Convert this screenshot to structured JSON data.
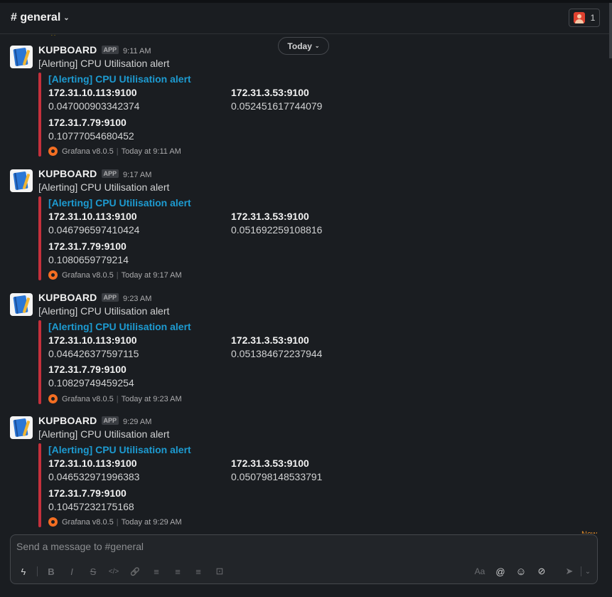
{
  "channel": {
    "title": "# general",
    "member_count": "1"
  },
  "date_divider": "Today",
  "messages": [
    {
      "sender": "KUPBOARD",
      "badge": "APP",
      "time": "9:11 AM",
      "text": "[Alerting] CPU Utilisation alert",
      "attachment": {
        "title": "[Alerting] CPU Utilisation alert",
        "fields": [
          {
            "name": "172.31.10.113:9100",
            "value": "0.047000903342374"
          },
          {
            "name": "172.31.3.53:9100",
            "value": "0.052451617744079"
          },
          {
            "name": "172.31.7.79:9100",
            "value": "0.10777054680452"
          }
        ],
        "footer": "Grafana v8.0.5",
        "footer_time": "Today at 9:11 AM"
      }
    },
    {
      "sender": "KUPBOARD",
      "badge": "APP",
      "time": "9:17 AM",
      "text": "[Alerting] CPU Utilisation alert",
      "attachment": {
        "title": "[Alerting] CPU Utilisation alert",
        "fields": [
          {
            "name": "172.31.10.113:9100",
            "value": "0.046796597410424"
          },
          {
            "name": "172.31.3.53:9100",
            "value": "0.051692259108816"
          },
          {
            "name": "172.31.7.79:9100",
            "value": "0.1080659779214"
          }
        ],
        "footer": "Grafana v8.0.5",
        "footer_time": "Today at 9:17 AM"
      }
    },
    {
      "sender": "KUPBOARD",
      "badge": "APP",
      "time": "9:23 AM",
      "text": "[Alerting] CPU Utilisation alert",
      "attachment": {
        "title": "[Alerting] CPU Utilisation alert",
        "fields": [
          {
            "name": "172.31.10.113:9100",
            "value": "0.046426377597115"
          },
          {
            "name": "172.31.3.53:9100",
            "value": "0.051384672237944"
          },
          {
            "name": "172.31.7.79:9100",
            "value": "0.10829749459254"
          }
        ],
        "footer": "Grafana v8.0.5",
        "footer_time": "Today at 9:23 AM"
      }
    },
    {
      "sender": "KUPBOARD",
      "badge": "APP",
      "time": "9:29 AM",
      "text": "[Alerting] CPU Utilisation alert",
      "attachment": {
        "title": "[Alerting] CPU Utilisation alert",
        "fields": [
          {
            "name": "172.31.10.113:9100",
            "value": "0.046532971996383"
          },
          {
            "name": "172.31.3.53:9100",
            "value": "0.050798148533791"
          },
          {
            "name": "172.31.7.79:9100",
            "value": "0.10457232175168"
          }
        ],
        "footer": "Grafana v8.0.5",
        "footer_time": "Today at 9:29 AM"
      }
    }
  ],
  "new_indicator": "New",
  "composer": {
    "placeholder": "Send a message to #general",
    "toolbar": {
      "shortcuts": "ϟ",
      "bold": "B",
      "italic": "I",
      "strike": "S",
      "code": "</>",
      "link": "🔗",
      "ordered_list": "≡",
      "bulleted_list": "≡",
      "blockquote": "≡",
      "code_block": "⊡",
      "text_format": "Aa",
      "mention": "@",
      "emoji": "☺",
      "attach": "⊘",
      "send": "➤",
      "send_options": "⌄"
    }
  },
  "colors": {
    "link": "#1d9bd1",
    "alert_bar": "#c5303c",
    "background": "#1a1d21"
  }
}
